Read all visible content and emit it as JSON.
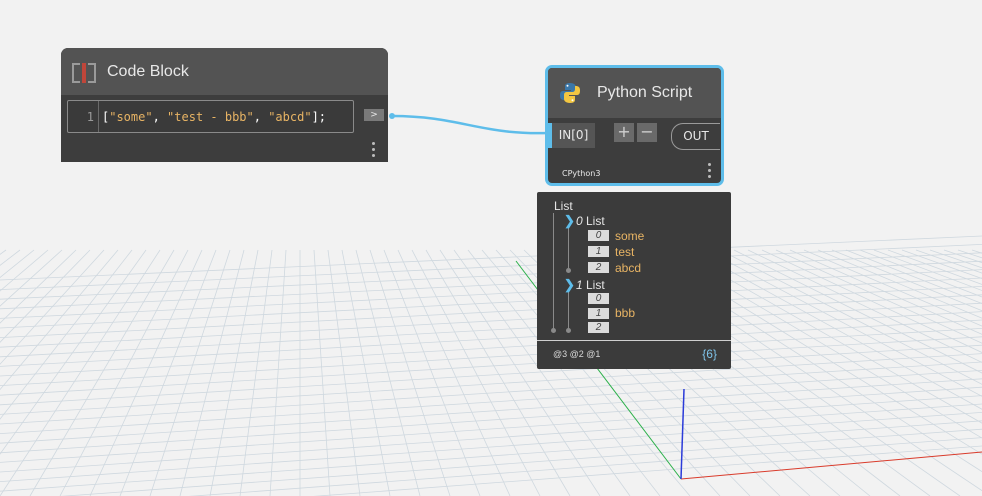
{
  "workspace": {
    "colors": {
      "background": "#f2f2f2",
      "grid": "#cfd8df",
      "wire": "#5ebdea",
      "x_axis": "#d93b2b",
      "y_axis": "#2bb04a",
      "z_axis": "#2b3bd9"
    }
  },
  "code_block": {
    "title": "Code Block",
    "icon": "code-block-icon",
    "line_number": "1",
    "code": "[\"some\", \"test - bbb\", \"abcd\"];",
    "out_port_label": ">"
  },
  "python_script": {
    "title": "Python Script",
    "icon": "python-logo-icon",
    "in_port": "IN[0]",
    "add_label": "+",
    "remove_label": "−",
    "out_port": "OUT",
    "engine": "CPython3"
  },
  "preview": {
    "root": "List",
    "items": [
      {
        "index": "0",
        "label": "List",
        "children": [
          {
            "index": "0",
            "value": "some"
          },
          {
            "index": "1",
            "value": "test"
          },
          {
            "index": "2",
            "value": "abcd"
          }
        ]
      },
      {
        "index": "1",
        "label": "List",
        "children": [
          {
            "index": "0",
            "value": ""
          },
          {
            "index": "1",
            "value": "bbb"
          },
          {
            "index": "2",
            "value": ""
          }
        ]
      }
    ],
    "levels": "@3 @2 @1",
    "count": "{6}"
  }
}
